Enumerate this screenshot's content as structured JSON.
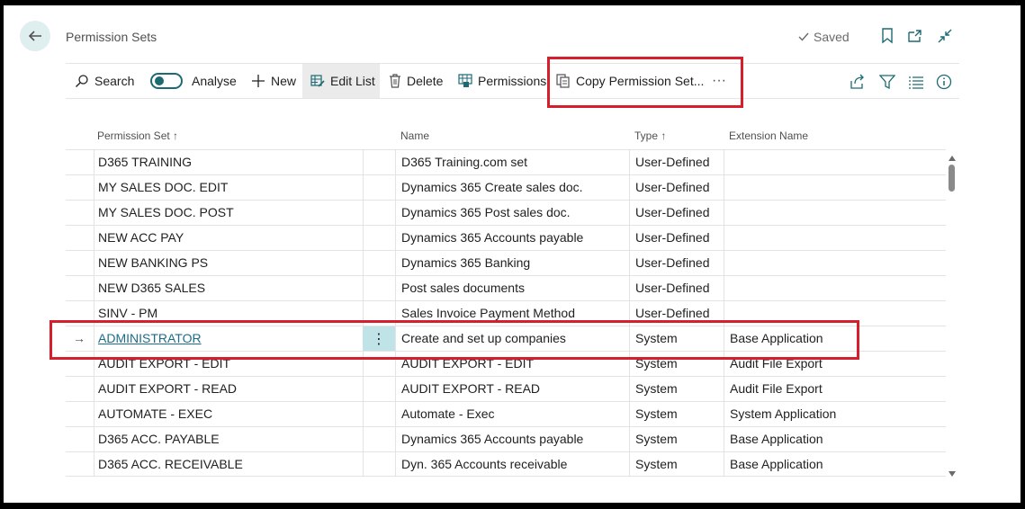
{
  "header": {
    "page_title": "Permission Sets",
    "saved_label": "Saved"
  },
  "toolbar": {
    "search": "Search",
    "analyse": "Analyse",
    "new": "New",
    "edit_list": "Edit List",
    "delete": "Delete",
    "permissions": "Permissions",
    "copy_permission_set": "Copy Permission Set...",
    "more": "···"
  },
  "columns": {
    "permission_set": "Permission Set ↑",
    "name": "Name",
    "type": "Type ↑",
    "extension_name": "Extension Name"
  },
  "rows": [
    {
      "permission_set": "D365 TRAINING",
      "name": "D365 Training.com set",
      "type": "User-Defined",
      "extension": ""
    },
    {
      "permission_set": "MY SALES DOC. EDIT",
      "name": "Dynamics 365 Create sales doc.",
      "type": "User-Defined",
      "extension": ""
    },
    {
      "permission_set": "MY SALES DOC. POST",
      "name": "Dynamics 365 Post sales doc.",
      "type": "User-Defined",
      "extension": ""
    },
    {
      "permission_set": "NEW ACC PAY",
      "name": "Dynamics 365 Accounts payable",
      "type": "User-Defined",
      "extension": ""
    },
    {
      "permission_set": "NEW BANKING PS",
      "name": "Dynamics 365 Banking",
      "type": "User-Defined",
      "extension": ""
    },
    {
      "permission_set": "NEW D365 SALES",
      "name": "Post sales documents",
      "type": "User-Defined",
      "extension": ""
    },
    {
      "permission_set": "SINV - PM",
      "name": "Sales Invoice Payment Method",
      "type": "User-Defined",
      "extension": ""
    },
    {
      "permission_set": "ADMINISTRATOR",
      "name": "Create and set up companies",
      "type": "System",
      "extension": "Base Application"
    },
    {
      "permission_set": "AUDIT EXPORT - EDIT",
      "name": "AUDIT EXPORT - EDIT",
      "type": "System",
      "extension": "Audit File Export"
    },
    {
      "permission_set": "AUDIT EXPORT - READ",
      "name": "AUDIT EXPORT - READ",
      "type": "System",
      "extension": "Audit File Export"
    },
    {
      "permission_set": "AUTOMATE - EXEC",
      "name": "Automate - Exec",
      "type": "System",
      "extension": "System Application"
    },
    {
      "permission_set": "D365 ACC. PAYABLE",
      "name": "Dynamics 365 Accounts payable",
      "type": "System",
      "extension": "Base Application"
    },
    {
      "permission_set": "D365 ACC. RECEIVABLE",
      "name": "Dyn. 365 Accounts receivable",
      "type": "System",
      "extension": "Base Application"
    }
  ],
  "selected_row_marker": "→",
  "row_menu_glyph": "⋮",
  "colors": {
    "accent": "#1c6a74",
    "highlight_box": "#d61f2c",
    "selected_cell": "#bfe3e6"
  }
}
